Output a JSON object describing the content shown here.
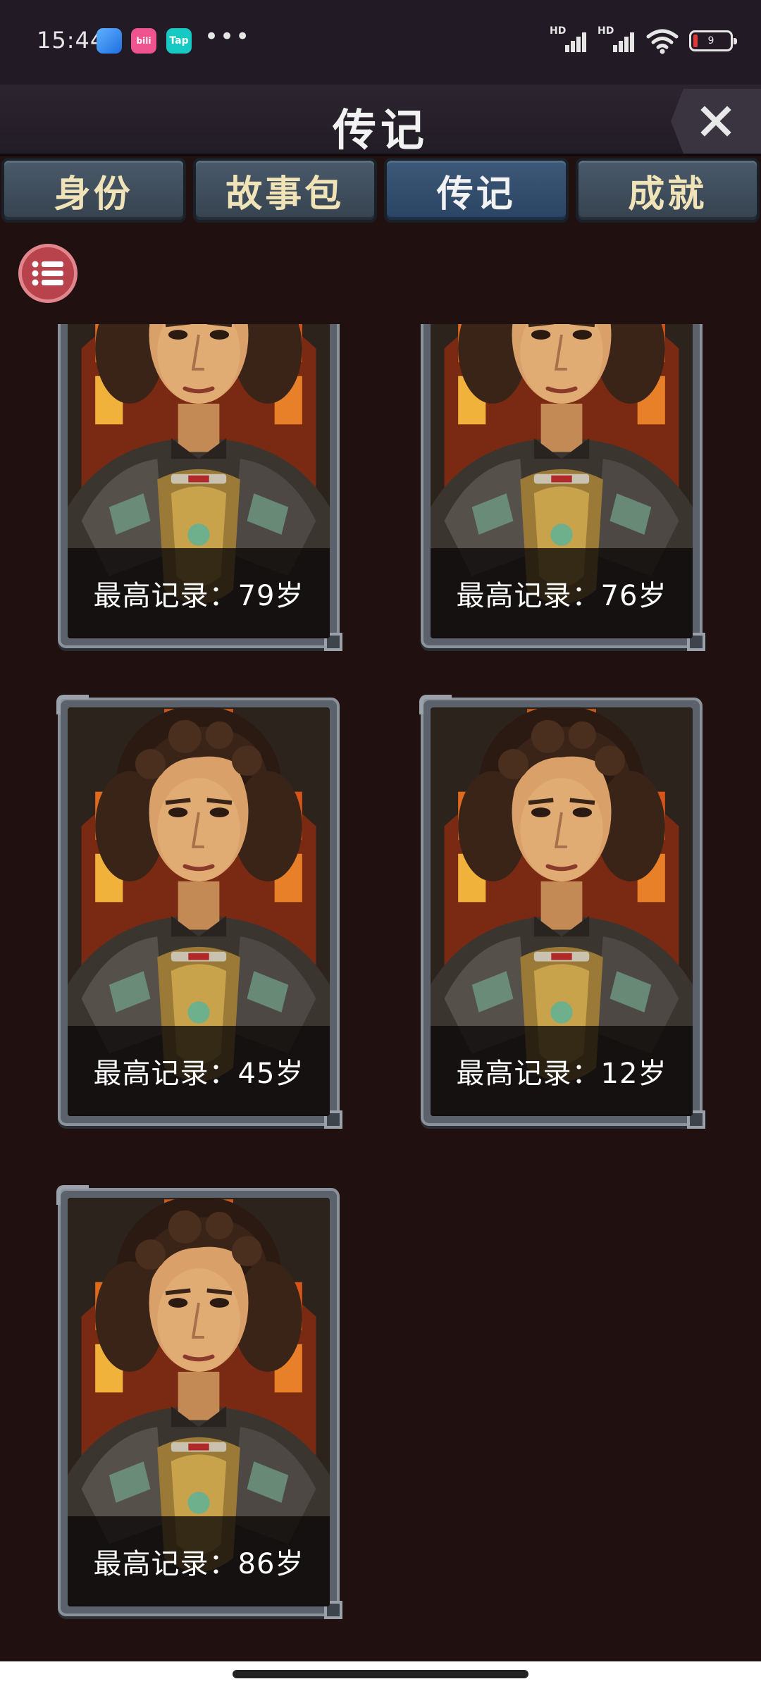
{
  "status_bar": {
    "time": "15:44",
    "apps": [
      "browser-app-icon",
      "bilibili-app-icon",
      "taptap-app-icon"
    ],
    "app_labels": [
      "",
      "bili",
      "Tap"
    ],
    "more": "•••",
    "signal1_label": "HD",
    "signal2_label": "HD",
    "battery_level": "9"
  },
  "header": {
    "title": "传记",
    "close_icon": "close-icon"
  },
  "tabs": [
    {
      "label": "身份",
      "active": false
    },
    {
      "label": "故事包",
      "active": false
    },
    {
      "label": "传记",
      "active": true
    },
    {
      "label": "成就",
      "active": false
    }
  ],
  "list_button_icon": "list-icon",
  "cards": [
    {
      "record": "最高记录：79岁"
    },
    {
      "record": "最高记录：76岁"
    },
    {
      "record": "最高记录：45岁"
    },
    {
      "record": "最高记录：12岁"
    },
    {
      "record": "最高记录：86岁"
    }
  ],
  "colors": {
    "background": "#211010",
    "tab_active": "#2a4563",
    "tab_text": "#f0e3b8",
    "list_button": "#b8434d"
  }
}
